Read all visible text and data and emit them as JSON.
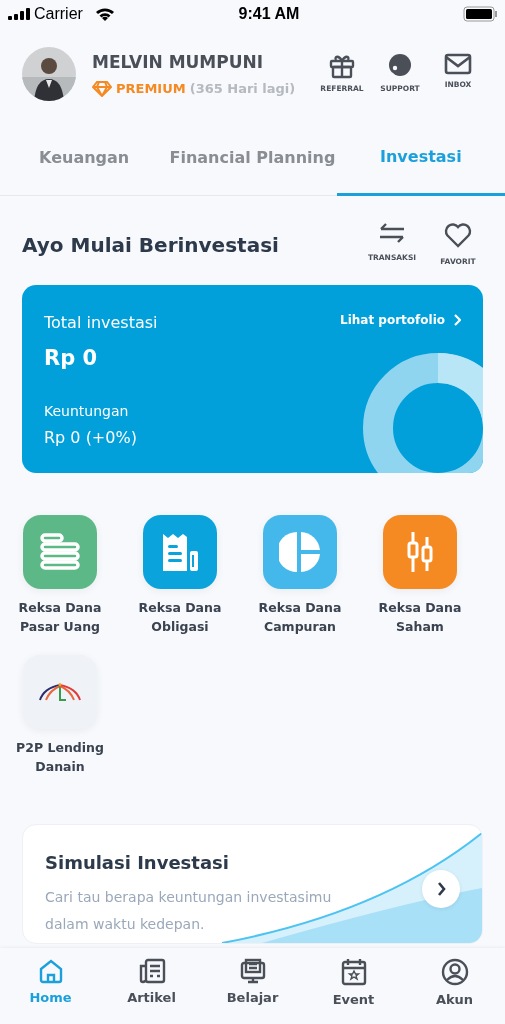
{
  "status_bar": {
    "carrier": "Carrier",
    "time": "9:41 AM"
  },
  "profile": {
    "name": "MELVIN MUMPUNI",
    "tier": "PREMIUM",
    "remaining": "(365 Hari lagi)"
  },
  "header_actions": [
    {
      "label": "REFERRAL"
    },
    {
      "label": "SUPPORT"
    },
    {
      "label": "INBOX"
    }
  ],
  "tabs": [
    {
      "label": "Keuangan",
      "selected": false
    },
    {
      "label": "Financial Planning",
      "selected": false
    },
    {
      "label": "Investasi",
      "selected": true
    }
  ],
  "section": {
    "title": "Ayo Mulai Berinvestasi",
    "actions": [
      {
        "label": "TRANSAKSI"
      },
      {
        "label": "FAVORIT"
      }
    ]
  },
  "portfolio_card": {
    "total_label": "Total investasi",
    "total_value": "Rp 0",
    "link": "Lihat portofolio",
    "profit_label": "Keuntungan",
    "profit_value": "Rp 0 (+0%)"
  },
  "products": [
    {
      "label": "Reksa Dana Pasar Uang",
      "color": "#5cb887"
    },
    {
      "label": "Reksa Dana Obligasi",
      "color": "#0aa3dc"
    },
    {
      "label": "Reksa Dana Campuran",
      "color": "#44b8ea"
    },
    {
      "label": "Reksa Dana Saham",
      "color": "#f58a22"
    },
    {
      "label": "P2P Lending Danain",
      "color": "#eff2f7"
    }
  ],
  "simulation": {
    "title": "Simulasi Investasi",
    "description": "Cari tau berapa keuntungan investasimu dalam waktu kedepan."
  },
  "bottom_nav": [
    {
      "label": "Home",
      "selected": true
    },
    {
      "label": "Artikel",
      "selected": false
    },
    {
      "label": "Belajar",
      "selected": false
    },
    {
      "label": "Event",
      "selected": false
    },
    {
      "label": "Akun",
      "selected": false
    }
  ]
}
